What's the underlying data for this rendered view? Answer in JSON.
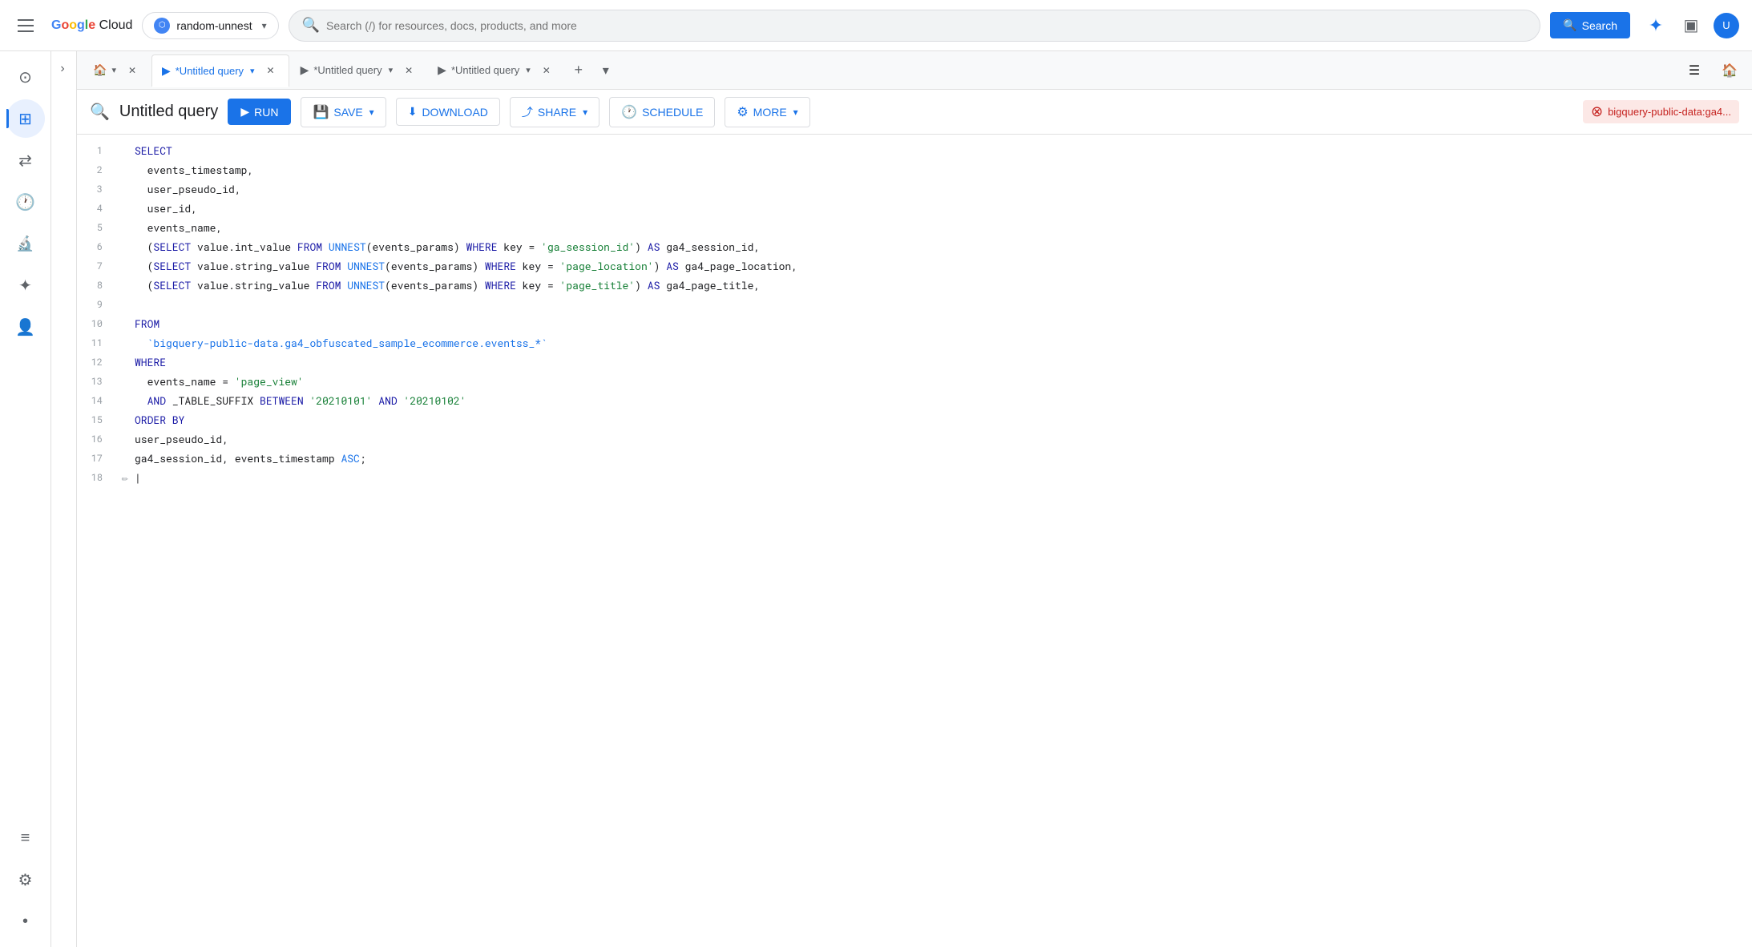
{
  "topNav": {
    "hamburgerLabel": "Main menu",
    "logoText": "Google Cloud",
    "projectSelector": {
      "label": "random-unnest",
      "icon": "project-icon"
    },
    "searchBar": {
      "placeholder": "Search (/) for resources, docs, products, and more",
      "buttonLabel": "Search"
    }
  },
  "tabs": {
    "home": {
      "label": ""
    },
    "items": [
      {
        "id": "tab1",
        "label": "*Untitled query",
        "active": true
      },
      {
        "id": "tab2",
        "label": "*Untitled query",
        "active": false
      },
      {
        "id": "tab3",
        "label": "*Untitled query",
        "active": false
      }
    ],
    "addLabel": "+",
    "moreLabel": "▾"
  },
  "queryEditor": {
    "title": "Untitled query",
    "runLabel": "RUN",
    "saveLabel": "SAVE",
    "downloadLabel": "DOWNLOAD",
    "shareLabel": "SHARE",
    "scheduleLabel": "SCHEDULE",
    "moreLabel": "MORE",
    "errorBadge": "bigquery-public-data:ga4..."
  },
  "code": {
    "lines": [
      {
        "num": 1,
        "content": "SELECT",
        "type": "keyword"
      },
      {
        "num": 2,
        "content": "  events_timestamp,",
        "type": "plain"
      },
      {
        "num": 3,
        "content": "  user_pseudo_id,",
        "type": "plain"
      },
      {
        "num": 4,
        "content": "  user_id,",
        "type": "plain"
      },
      {
        "num": 5,
        "content": "  events_name,",
        "type": "plain"
      },
      {
        "num": 6,
        "content": "  (SELECT value.int_value FROM UNNEST(events_params) WHERE key = 'ga_session_id') AS ga4_session_id,",
        "type": "subquery"
      },
      {
        "num": 7,
        "content": "  (SELECT value.string_value FROM UNNEST(events_params) WHERE key = 'page_location') AS ga4_page_location,",
        "type": "subquery"
      },
      {
        "num": 8,
        "content": "  (SELECT value.string_value FROM UNNEST(events_params) WHERE key = 'page_title') AS ga4_page_title,",
        "type": "subquery"
      },
      {
        "num": 9,
        "content": "",
        "type": "empty"
      },
      {
        "num": 10,
        "content": "FROM",
        "type": "keyword"
      },
      {
        "num": 11,
        "content": "  `bigquery-public-data.ga4_obfuscated_sample_ecommerce.eventss_*`",
        "type": "table"
      },
      {
        "num": 12,
        "content": "WHERE",
        "type": "keyword"
      },
      {
        "num": 13,
        "content": "  events_name = 'page_view'",
        "type": "where"
      },
      {
        "num": 14,
        "content": "  AND _TABLE_SUFFIX BETWEEN '20210101' AND '20210102'",
        "type": "where2"
      },
      {
        "num": 15,
        "content": "ORDER BY",
        "type": "keyword"
      },
      {
        "num": 16,
        "content": "user_pseudo_id,",
        "type": "plain"
      },
      {
        "num": 17,
        "content": "ga4_session_id, events_timestamp ASC;",
        "type": "asc"
      },
      {
        "num": 18,
        "content": "",
        "type": "cursor"
      }
    ]
  },
  "sidebar": {
    "items": [
      {
        "id": "search",
        "icon": "🔍",
        "label": "Search"
      },
      {
        "id": "dashboard",
        "icon": "⊞",
        "label": "Dashboard",
        "active": true
      },
      {
        "id": "transfer",
        "icon": "⇄",
        "label": "Transfers"
      },
      {
        "id": "history",
        "icon": "🕐",
        "label": "History"
      },
      {
        "id": "explore",
        "icon": "🔬",
        "label": "Explore"
      },
      {
        "id": "workflow",
        "icon": "✈",
        "label": "Workflows"
      },
      {
        "id": "dataplex",
        "icon": "👤",
        "label": "Dataplex"
      },
      {
        "id": "filter",
        "icon": "≡",
        "label": "Filter"
      },
      {
        "id": "settings",
        "icon": "⚙",
        "label": "Settings"
      },
      {
        "id": "dot",
        "icon": "•",
        "label": "More"
      }
    ]
  }
}
